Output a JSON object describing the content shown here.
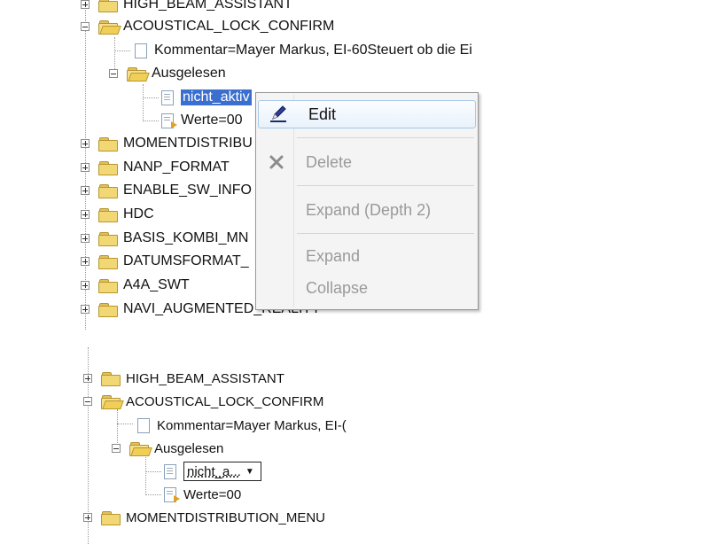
{
  "top_tree": {
    "high_beam": "HIGH_BEAM_ASSISTANT",
    "acoustical": "ACOUSTICAL_LOCK_CONFIRM",
    "kommentar": "Kommentar=Mayer Markus, EI-60Steuert ob die Ei",
    "ausgelesen": "Ausgelesen",
    "nicht_aktiv": "nicht_aktiv",
    "werte": "Werte=00",
    "items": [
      "MOMENTDISTRIBU",
      "NANP_FORMAT",
      "ENABLE_SW_INFO",
      "HDC",
      "BASIS_KOMBI_MN",
      "DATUMSFORMAT_",
      "A4A_SWT",
      "NAVI_AUGMENTED_REALITY"
    ]
  },
  "context_menu": {
    "edit": "Edit",
    "delete": "Delete",
    "expand_depth": "Expand (Depth 2)",
    "expand": "Expand",
    "collapse": "Collapse",
    "icons": {
      "edit": "pen-icon",
      "delete": "x-icon"
    }
  },
  "bottom_tree": {
    "high_beam": "HIGH_BEAM_ASSISTANT",
    "acoustical": "ACOUSTICAL_LOCK_CONFIRM",
    "kommentar": "Kommentar=Mayer Markus, EI-(",
    "ausgelesen": "Ausgelesen",
    "inplace_value": "nicht_a...",
    "werte": "Werte=00",
    "moment": "MOMENTDISTRIBUTION_MENU"
  }
}
